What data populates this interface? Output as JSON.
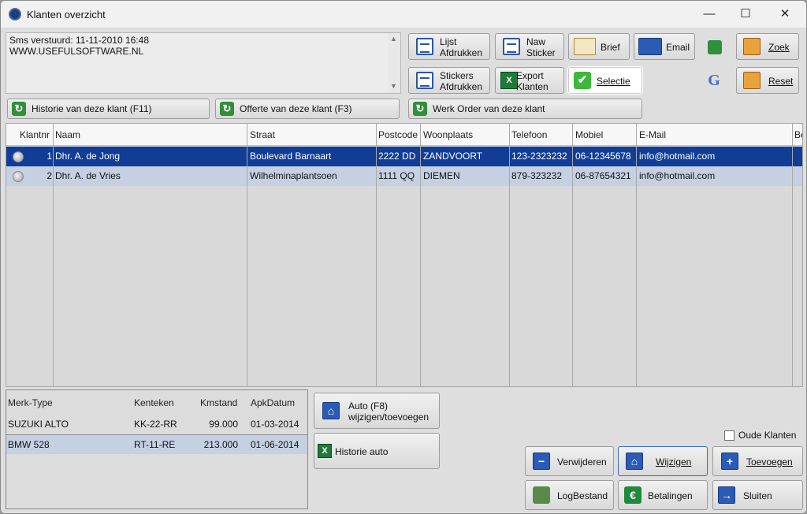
{
  "window": {
    "title": "Klanten overzicht",
    "minimize": "—",
    "maximize": "☐",
    "close": "✕"
  },
  "sms": {
    "line1": "Sms verstuurd: 11-11-2010 16:48",
    "line2": "WWW.USEFULSOFTWARE.NL",
    "scroll_up": "▲",
    "scroll_down": "▼"
  },
  "toolbar": {
    "lijst_afdrukken_1": "Lijst",
    "lijst_afdrukken_2": "Afdrukken",
    "naw_sticker_1": "Naw",
    "naw_sticker_2": "Sticker",
    "brief": "Brief",
    "email": "Email",
    "stickers_afdrukken_1": "Stickers",
    "stickers_afdrukken_2": "Afdrukken",
    "export_klanten_1": "Export",
    "export_klanten_2": "Klanten",
    "selectie": "Selectie",
    "zoek": "Zoek",
    "reset": "Reset",
    "google_glyph": "G",
    "check_glyph": "✔"
  },
  "action_links": {
    "historie": "Historie van deze klant (F11)",
    "offerte": "Offerte van deze klant (F3)",
    "werkorder": "Werk Order van deze klant"
  },
  "grid": {
    "columns": [
      "Klantnr",
      "Naam",
      "Straat",
      "Postcode",
      "Woonplaats",
      "Telefoon",
      "Mobiel",
      "E-Mail",
      "Be"
    ],
    "rows": [
      [
        "1",
        "Dhr. A. de Jong",
        "Boulevard Barnaart",
        "2222 DD",
        "ZANDVOORT",
        "123-2323232",
        "06-12345678",
        "info@hotmail.com",
        ""
      ],
      [
        "2",
        "Dhr. A. de Vries",
        "Wilhelminaplantsoen",
        "1111 QQ",
        "DIEMEN",
        "879-323232",
        "06-87654321",
        "info@hotmail.com",
        ""
      ]
    ],
    "selected_row": 1
  },
  "cars": {
    "columns": [
      "Merk-Type",
      "Kenteken",
      "Kmstand",
      "ApkDatum"
    ],
    "rows": [
      [
        "SUZUKI ALTO",
        "KK-22-RR",
        "99.000",
        "01-03-2014"
      ],
      [
        "BMW 528",
        "RT-11-RE",
        "213.000",
        "01-06-2014"
      ]
    ]
  },
  "car_buttons": {
    "auto_1": "Auto (F8)",
    "auto_2": "wijzigen/toevoegen",
    "historie_auto": "Historie auto"
  },
  "bottom": {
    "oude_klanten": "Oude Klanten",
    "verwijderen": "Verwijderen",
    "wijzigen": "Wijzigen",
    "toevoegen": "Toevoegen",
    "logbestand": "LogBestand",
    "betalingen": "Betalingen",
    "sluiten": "Sluiten",
    "euro_glyph": "€"
  }
}
